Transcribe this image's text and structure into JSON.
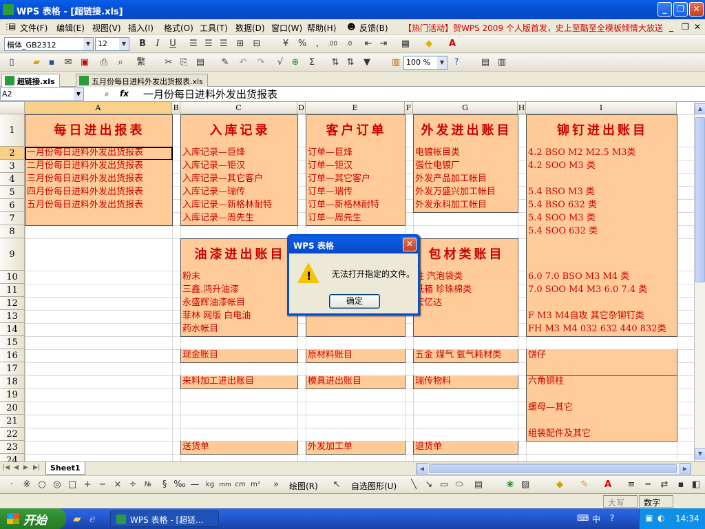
{
  "window": {
    "title": "WPS 表格 - [超链接.xls]"
  },
  "menu": [
    "文件(F)",
    "编辑(E)",
    "视图(V)",
    "插入(I)",
    "格式(O)",
    "工具(T)",
    "数据(D)",
    "窗口(W)",
    "帮助(H)",
    "反馈(B)"
  ],
  "promo": "【热门活动】贺WPS 2009 个人版首发，史上至酷至全模板倾情大放送",
  "format_toolbar": {
    "font": "楷体_GB2312",
    "size": "12",
    "zoom": "100 %"
  },
  "file_tabs": [
    "超链接.xls",
    "五月份每日进料外发出货报表.xls"
  ],
  "formula_bar": {
    "name_box": "A2",
    "fx": "fx",
    "content": "一月份每日进料外发出货报表"
  },
  "columns": [
    "A",
    "B",
    "C",
    "D",
    "E",
    "F",
    "G",
    "H",
    "I"
  ],
  "rows": [
    "1",
    "2",
    "3",
    "4",
    "5",
    "6",
    "7",
    "8",
    "9",
    "10",
    "11",
    "12",
    "13",
    "14",
    "15",
    "16",
    "17",
    "18",
    "19",
    "20",
    "21",
    "22",
    "23",
    "24"
  ],
  "cells": {
    "a_header": "每日进出报表",
    "a": [
      "一月份每日进料外发出货报表",
      "二月份每日进料外发出货报表",
      "三月份每日进料外发出货报表",
      "四月份每日进料外发出货报表",
      "五月份每日进料外发出货报表"
    ],
    "c_header": "入库记录",
    "c": [
      "入库记录—巨烽",
      "入库记录—钜汉",
      "入库记录—其它客户",
      "入库记录—瑞传",
      "入库记录—新格林耐特",
      "入库记录—周先生"
    ],
    "e_header": "客户订单",
    "e": [
      "订单—巨烽",
      "订单—钜汉",
      "订单—其它客户",
      "订单—瑞传",
      "订单—新格林耐特",
      "订单—周先生"
    ],
    "g_header": "外发进出账目",
    "g": [
      "电镀帐目类",
      "强仕电镀厂",
      "外发产品加工帐目",
      "外发万盛兴加工帐目",
      "外发永科加工帐目"
    ],
    "i_header": "铆钉进出账目",
    "i": [
      "4.2 BSO M2 M2.5 M3类",
      "4.2 SOO M3 类",
      "",
      "5.4 BSO M3 类",
      "5.4 BSO 632 类",
      "5.4 SOO M3 类",
      "5.4 SOO 632 类"
    ],
    "c2_header": "油漆进出账目",
    "c2": [
      "粉末",
      "三鑫.鸿升油漆",
      "永盛辉油漆帐目",
      "菲林 网版 白电油",
      "药水帐目"
    ],
    "g2_header": "包材类账目",
    "g2": [
      "胜 汽泡袋类",
      "纸箱 珍珠棉类",
      "宏亿达"
    ],
    "i2": [
      "6.0 7.0 BSO M3 M4 类",
      "7.0 SOO M4 M3 6.0 7.4 类",
      "",
      "F M3 M4自攻 其它杂铆钉类",
      "FH M3 M4 032 632 440 832类"
    ],
    "r16": [
      "现金账目",
      "原材料账目",
      "五金 煤气 氩气耗材类",
      "饼仔"
    ],
    "r18": [
      "来料加工进出账目",
      "模具进出账目",
      "瑞传物料",
      "六角铜柱"
    ],
    "r20_i": "螺母—其它",
    "r22_i": "组装配件及其它",
    "r23": [
      "送货单",
      "外发加工单",
      "退货单"
    ]
  },
  "sheet_tab": "Sheet1",
  "draw_toolbar": {
    "draw": "绘图(R)",
    "autoshape": "自选图形(U)"
  },
  "status": {
    "caps": "大写",
    "num": "数字"
  },
  "dialog": {
    "title": "WPS 表格",
    "message": "无法打开指定的文件。",
    "ok": "确定"
  },
  "taskbar": {
    "start": "开始",
    "window": "WPS 表格 - [超链...",
    "time": "14:34"
  },
  "colors": {
    "cell_fill": "#FFCC99",
    "cell_text": "#CC0000",
    "title_bar": "#0A5FE8"
  }
}
